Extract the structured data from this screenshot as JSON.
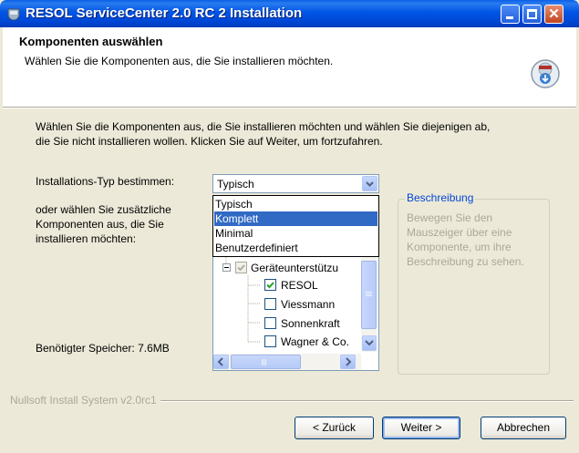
{
  "window": {
    "title": "RESOL ServiceCenter 2.0 RC 2 Installation",
    "controls": [
      "minimize",
      "maximize",
      "close"
    ],
    "accent_color": "#0054e3"
  },
  "header": {
    "title": "Komponenten auswählen",
    "subtitle": "Wählen Sie die Komponenten aus, die Sie installieren möchten.",
    "icon": "installer-disk-icon"
  },
  "body": {
    "description_line1": "Wählen Sie die Komponenten aus, die Sie installieren möchten und wählen Sie diejenigen ab,",
    "description_line2": "die Sie nicht installieren wollen. Klicken Sie auf Weiter, um fortzufahren.",
    "install_type_label": "Installations-Typ bestimmen:",
    "select_components_label": [
      "oder wählen Sie zusätzliche",
      "Komponenten aus, die Sie",
      "installieren möchten:"
    ],
    "space_required": "Benötigter Speicher: 7.6MB"
  },
  "install_type": {
    "selected": "Typisch",
    "options": [
      "Typisch",
      "Komplett",
      "Minimal",
      "Benutzerdefiniert"
    ],
    "highlighted": "Komplett"
  },
  "tree": {
    "group": {
      "label": "Geräteunterstützu",
      "state": "partial"
    },
    "items": [
      {
        "label": "RESOL",
        "checked": true
      },
      {
        "label": "Viessmann",
        "checked": false
      },
      {
        "label": "Sonnenkraft",
        "checked": false
      },
      {
        "label": "Wagner & Co.",
        "checked": false
      }
    ]
  },
  "description_box": {
    "title": "Beschreibung",
    "lines": [
      "Bewegen Sie den",
      "Mauszeiger über eine",
      "Komponente, um ihre",
      "Beschreibung zu sehen."
    ]
  },
  "footer": {
    "branding": "Nullsoft Install System v2.0rc1",
    "back_label": "< Zurück",
    "next_label": "Weiter >",
    "cancel_label": "Abbrechen"
  }
}
